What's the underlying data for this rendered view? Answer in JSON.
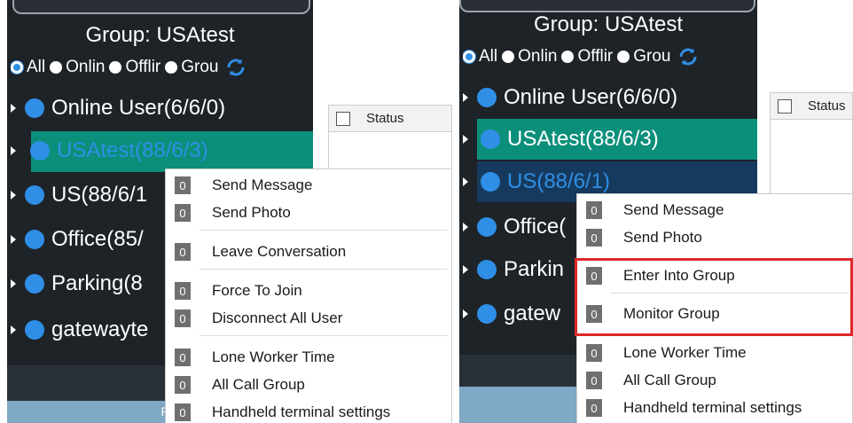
{
  "left_panel": {
    "group_title": "Group:  USAtest",
    "filters": [
      {
        "label": "All",
        "checked": true
      },
      {
        "label": "Onlin",
        "checked": false
      },
      {
        "label": "Offlir",
        "checked": false
      },
      {
        "label": "Grou",
        "checked": false
      }
    ],
    "tree": [
      {
        "label": "Online User(6/6/0)",
        "state": "normal"
      },
      {
        "label": "USAtest(88/6/3)",
        "state": "selected-teal"
      },
      {
        "label": "US(88/6/1",
        "state": "normal"
      },
      {
        "label": "Office(85/",
        "state": "normal"
      },
      {
        "label": "Parking(8",
        "state": "normal"
      },
      {
        "label": "gatewayte",
        "state": "normal"
      }
    ],
    "status_header": "Status",
    "bottom_bar_text": "PT",
    "context_menu": [
      {
        "badge": "0",
        "label": "Send Message"
      },
      {
        "badge": "0",
        "label": "Send Photo"
      },
      {
        "badge": "0",
        "label": "Leave Conversation"
      },
      {
        "badge": "0",
        "label": "Force To Join"
      },
      {
        "badge": "0",
        "label": "Disconnect All User"
      },
      {
        "badge": "0",
        "label": "Lone Worker Time"
      },
      {
        "badge": "0",
        "label": "All Call Group"
      },
      {
        "badge": "0",
        "label": "Handheld terminal settings"
      }
    ]
  },
  "right_panel": {
    "group_title": "Group:  USAtest",
    "filters": [
      {
        "label": "All",
        "checked": true
      },
      {
        "label": "Onlin",
        "checked": false
      },
      {
        "label": "Offlir",
        "checked": false
      },
      {
        "label": "Grou",
        "checked": false
      }
    ],
    "tree": [
      {
        "label": "Online User(6/6/0)",
        "state": "normal"
      },
      {
        "label": "USAtest(88/6/3)",
        "state": "selected-teal"
      },
      {
        "label": "US(88/6/1)",
        "state": "selected-navy"
      },
      {
        "label": "Office(",
        "state": "normal"
      },
      {
        "label": "Parkin",
        "state": "normal"
      },
      {
        "label": "gatew",
        "state": "normal"
      }
    ],
    "status_header": "Status",
    "context_menu": [
      {
        "badge": "0",
        "label": "Send Message"
      },
      {
        "badge": "0",
        "label": "Send Photo"
      },
      {
        "badge": "0",
        "label": "Enter Into Group"
      },
      {
        "badge": "0",
        "label": "Monitor Group"
      },
      {
        "badge": "0",
        "label": "Lone Worker Time"
      },
      {
        "badge": "0",
        "label": "All Call Group"
      },
      {
        "badge": "0",
        "label": "Handheld terminal settings"
      }
    ]
  },
  "colors": {
    "tree_background": "#1e2328",
    "selected_teal": "#0b8f7a",
    "selected_navy": "#163a5e",
    "status_dot": "#2f8fe6",
    "highlight_border": "#e02828"
  },
  "icons": [
    "refresh-icon",
    "expand-arrow-icon",
    "status-dot-icon",
    "checkbox-icon",
    "count-badge-icon"
  ]
}
